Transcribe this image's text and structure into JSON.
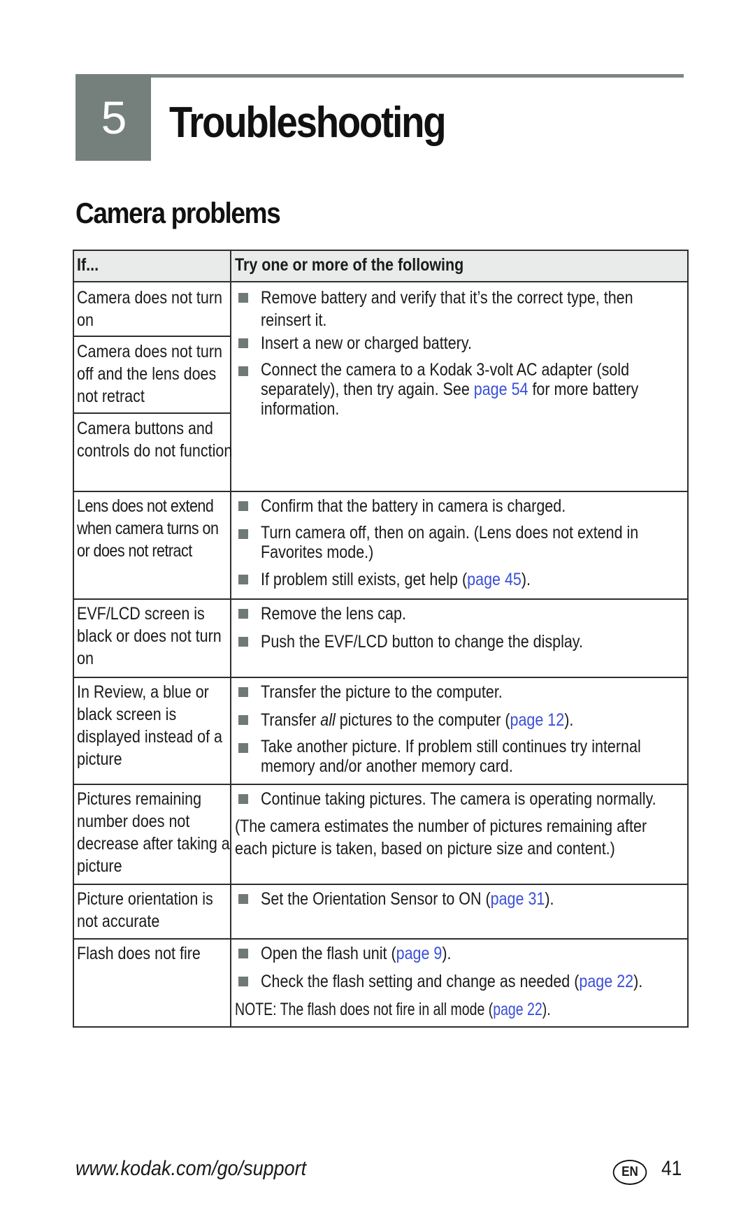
{
  "chapter": {
    "number": "5",
    "title": "Troubleshooting"
  },
  "section": {
    "title": "Camera problems"
  },
  "table": {
    "headers": [
      "If...",
      "Try one or more of the following"
    ],
    "rows": [
      {
        "problems": [
          "Camera does not turn on",
          "Camera does not turn off and the lens does not retract",
          "Camera buttons and controls do not function"
        ],
        "solutions": [
          {
            "pre": "Remove battery and verify that it’s the correct type, then",
            "line2": "reinsert it."
          },
          {
            "pre": "Insert a new or charged battery."
          },
          {
            "pre": "Connect the camera to a Kodak 3-volt AC adapter (sold",
            "line2_pre": "separately), then try again. See ",
            "link": "page 54",
            "line2_post": " for more battery",
            "line3": "information."
          }
        ]
      },
      {
        "problems": [
          "Lens does not extend when camera turns on or does not retract"
        ],
        "solutions": [
          {
            "pre": "Confirm that the battery in camera is charged."
          },
          {
            "pre": "Turn camera off, then on again. (Lens does not extend in",
            "line2": "Favorites mode.)"
          },
          {
            "pre": "If problem still exists, get help (",
            "link": "page 45",
            "post": ")."
          }
        ]
      },
      {
        "problems": [
          "EVF/LCD screen is black or does not turn on"
        ],
        "solutions": [
          {
            "pre": "Remove the lens cap."
          },
          {
            "pre": "Push the EVF/LCD button to change the display."
          }
        ]
      },
      {
        "problems": [
          "In Review, a blue or black screen is displayed instead of a picture"
        ],
        "solutions": [
          {
            "pre": "Transfer the picture to the computer."
          },
          {
            "pre": "Transfer ",
            "em": "all",
            "mid": " pictures to the computer (",
            "link": "page 12",
            "post": ")."
          },
          {
            "pre": "Take another picture. If problem still continues try internal",
            "line2": "memory and/or another memory card."
          }
        ]
      },
      {
        "problems": [
          "Pictures remaining number does not decrease after taking a picture"
        ],
        "solutions": [
          {
            "pre": "Continue taking pictures. The camera is operating normally."
          }
        ],
        "note": [
          "(The camera estimates the number of pictures remaining after",
          "each picture is taken, based on picture size and content.)"
        ]
      },
      {
        "problems": [
          "Picture orientation is not accurate"
        ],
        "solutions": [
          {
            "pre": "Set the Orientation Sensor to ON (",
            "link": "page 31",
            "post": ")."
          }
        ]
      },
      {
        "problems": [
          "Flash does not fire"
        ],
        "solutions": [
          {
            "pre": "Open the flash unit (",
            "link": "page 9",
            "post": ")."
          },
          {
            "pre": "Check the flash setting and change as needed (",
            "link": "page 22",
            "post": ")."
          }
        ],
        "note": {
          "pre": "NOTE:  The flash does not fire in all mode (",
          "link": "page 22",
          "post": ")."
        }
      }
    ]
  },
  "footer": {
    "url": "www.kodak.com/go/support",
    "lang_badge": "EN",
    "page_number": "41"
  },
  "colors": {
    "link": "#3a4fd8",
    "chapter_box": "#75807d",
    "header_bg": "#e8ebea",
    "bullet": "#6f7a77"
  }
}
